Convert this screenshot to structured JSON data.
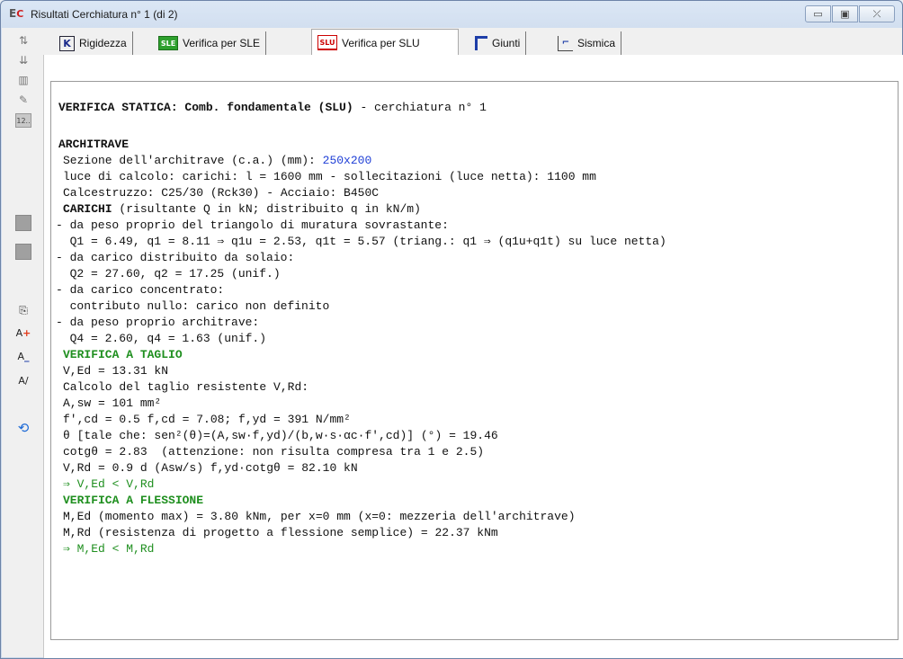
{
  "window": {
    "title": "Risultati Cerchiatura n° 1 (di 2)",
    "buttons": {
      "minimize": "▭",
      "maximize": "▣",
      "close": "⤫"
    }
  },
  "tabs": [
    {
      "label": "Rigidezza",
      "icon": "K"
    },
    {
      "label": "Verifica per SLE",
      "icon": "SLE"
    },
    {
      "label": "Verifica per SLU",
      "icon": "SLU",
      "active": true
    },
    {
      "label": "Giunti",
      "icon": "giunti-icon"
    },
    {
      "label": "Sismica",
      "icon": "sismica-icon"
    }
  ],
  "left_toolbar": {
    "icons": [
      "tool-1-icon",
      "tool-2-icon",
      "chart-icon",
      "edit-icon",
      "12-icon",
      "gray-1",
      "gray-2",
      "copy-icon",
      "font-plus-icon",
      "font-minus-icon",
      "font-italic-icon",
      "refresh-icon"
    ],
    "label_12": "12.."
  },
  "report": {
    "header_pre": "VERIFICA STATICA: Comb. fondamentale (SLU)",
    "header_post": " - cerchiatura n° 1",
    "architrave": "ARCHITRAVE",
    "sezione_pre": "Sezione dell'architrave (c.a.) (mm): ",
    "sezione_val": "250x200",
    "luce": "luce di calcolo: carichi: l = 1600 mm - sollecitazioni (luce netta): 1100 mm",
    "materiali": "Calcestruzzo: C25/30 (Rck30) - Acciaio: B450C",
    "carichi_b": "CARICHI",
    "carichi_rest": " (risultante Q in kN; distribuito q in kN/m)",
    "l1": "- da peso proprio del triangolo di muratura sovrastante:",
    "l2": "  Q1 = 6.49, q1 = 8.11 ⇒ q1u = 2.53, q1t = 5.57 (triang.: q1 ⇒ (q1u+q1t) su luce netta)",
    "l3": "- da carico distribuito da solaio:",
    "l4": "  Q2 = 27.60, q2 = 17.25 (unif.)",
    "l5": "- da carico concentrato:",
    "l6": "  contributo nullo: carico non definito",
    "l7": "- da peso proprio architrave:",
    "l8": "  Q4 = 2.60, q4 = 1.63 (unif.)",
    "taglio_title": "VERIFICA A TAGLIO",
    "t1": "V,Ed = 13.31 kN",
    "t2": "Calcolo del taglio resistente V,Rd:",
    "t3": "A,sw = 101 mm²",
    "t4": "f',cd = 0.5 f,cd = 7.08; f,yd = 391 N/mm²",
    "t5": "θ [tale che: sen²(θ)=(A,sw·f,yd)/(b,w·s·αc·f',cd)] (°) = 19.46",
    "t6": "cotgθ = 2.83  (attenzione: non risulta compresa tra 1 e 2.5)",
    "t7": "V,Rd = 0.9 d (Asw/s) f,yd·cotgθ = 82.10 kN",
    "t8": "⇒ V,Ed < V,Rd",
    "flessione_title": "VERIFICA A FLESSIONE",
    "f1": "M,Ed (momento max) = 3.80 kNm, per x=0 mm (x=0: mezzeria dell'architrave)",
    "f2": "M,Rd (resistenza di progetto a flessione semplice) = 22.37 kNm",
    "f3": "⇒ M,Ed < M,Rd"
  }
}
